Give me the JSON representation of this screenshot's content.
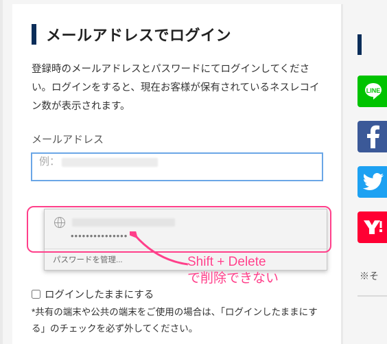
{
  "heading": "メールアドレスでログイン",
  "description": "登録時のメールアドレスとパスワードにてログインしてください。ログインをすると、現在お客様が保有されているネスレコイン数が表示されます。",
  "email_label": "メールアドレス",
  "email_placeholder_prefix": "例：",
  "autofill": {
    "password_mask": "•••••••••••••••",
    "manage_label": "パスワードを管理..."
  },
  "annotation": {
    "line1": "Shift + Delete",
    "line2": "で削除できない"
  },
  "remember_label": "ログインしたままにする",
  "remember_hint": "*共有の端末や公共の端末をご使用の場合は、「ログインしたままにする」のチェックを必ず外してください。",
  "side_note": "※そ",
  "social": {
    "line": "LINE",
    "facebook": "f",
    "twitter": "t",
    "yahoo": "Y"
  }
}
